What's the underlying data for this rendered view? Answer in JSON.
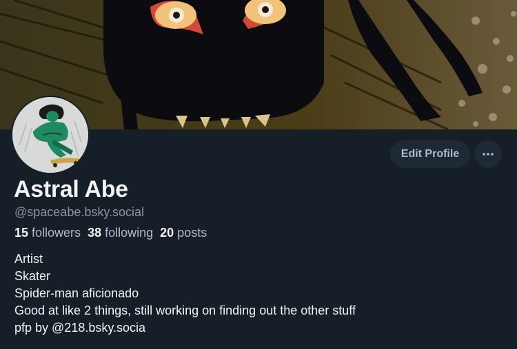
{
  "profile": {
    "display_name": "Astral Abe",
    "handle": "@spaceabe.bsky.social",
    "stats": {
      "followers_count": "15",
      "followers_label": "followers",
      "following_count": "38",
      "following_label": "following",
      "posts_count": "20",
      "posts_label": "posts"
    },
    "bio_lines": [
      "Artist",
      "Skater",
      "Spider-man aficionado",
      "Good at like 2 things, still working on finding out the other stuff",
      "pfp by @218.bsky.socia"
    ]
  },
  "actions": {
    "edit_profile_label": "Edit Profile",
    "more_icon": "ellipsis-icon"
  },
  "colors": {
    "background": "#161e27",
    "button_bg": "#1e2936",
    "button_text": "#aebbc9",
    "muted_text": "#8896a6",
    "primary_text": "#f1f3f5"
  }
}
